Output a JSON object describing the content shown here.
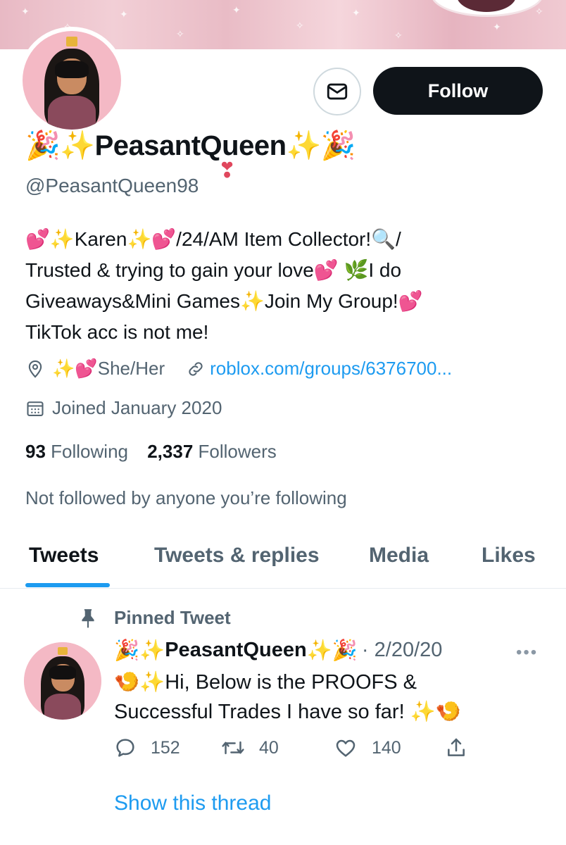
{
  "profile": {
    "name_prefix_emoji": "🎉✨",
    "name": "PeasantQueen",
    "name_suffix_emoji": "✨🎉",
    "handle": "@PeasantQueen98",
    "bio_lines": [
      "💕✨Karen✨💕/24/AM Item Collector!🔍/",
      "Trusted & trying to gain your love💕 🌿I do",
      "Giveaways&Mini Games✨Join My Group!💕",
      "TikTok acc is not me!"
    ],
    "location_emoji": "✨💕",
    "location": "She/Her",
    "website": "roblox.com/groups/6376700...",
    "joined": "Joined January 2020",
    "following_count": "93",
    "following_label": "Following",
    "followers_count": "2,337",
    "followers_label": "Followers",
    "not_followed_text": "Not followed by anyone you’re following"
  },
  "buttons": {
    "follow_label": "Follow"
  },
  "tabs": [
    {
      "label": "Tweets",
      "active": true
    },
    {
      "label": "Tweets & replies",
      "active": false
    },
    {
      "label": "Media",
      "active": false
    },
    {
      "label": "Likes",
      "active": false
    }
  ],
  "pinned_tweet": {
    "pinned_label": "Pinned Tweet",
    "author_prefix_emoji": "🎉✨",
    "author": "PeasantQueen",
    "author_suffix_emoji": "✨🎉",
    "date": "· 2/20/20",
    "text_lines": [
      "🍤✨Hi, Below is the PROOFS &",
      "Successful Trades I have so far! ✨🍤"
    ],
    "replies": "152",
    "retweets": "40",
    "likes": "140",
    "show_thread": "Show this thread"
  },
  "icons": {
    "mail": "mail-icon",
    "location": "location-pin-icon",
    "link": "link-icon",
    "calendar": "calendar-icon",
    "pin": "pin-icon",
    "more": "more-icon",
    "reply": "reply-icon",
    "retweet": "retweet-icon",
    "like": "heart-icon",
    "share": "share-icon"
  },
  "colors": {
    "accent": "#1d9bf0",
    "text_primary": "#0f1419",
    "text_secondary": "#536471",
    "follow_button": "#0f1419"
  }
}
